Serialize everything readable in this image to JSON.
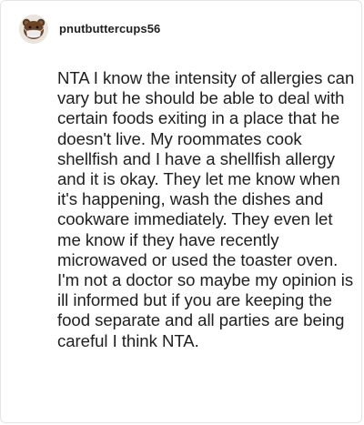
{
  "comment": {
    "username": "pnutbuttercups56",
    "avatar_icon": "bear-with-mask-avatar",
    "text": "NTA I know the intensity of allergies can vary but he should be able to deal with certain foods exiting in a place that he doesn't live. My roommates cook shellfish and I have a shellfish allergy and it is okay. They let me know when it's happening, wash the dishes and cookware immediately. They even let me know if they have recently microwaved or used the toaster oven. I'm not a doctor so maybe my opinion is ill informed but if you are keeping the food separate and all parties are being careful I think NTA."
  },
  "colors": {
    "text": "#202020",
    "username": "#1f1f1f",
    "border": "#e5e5e5",
    "background": "#ffffff"
  }
}
